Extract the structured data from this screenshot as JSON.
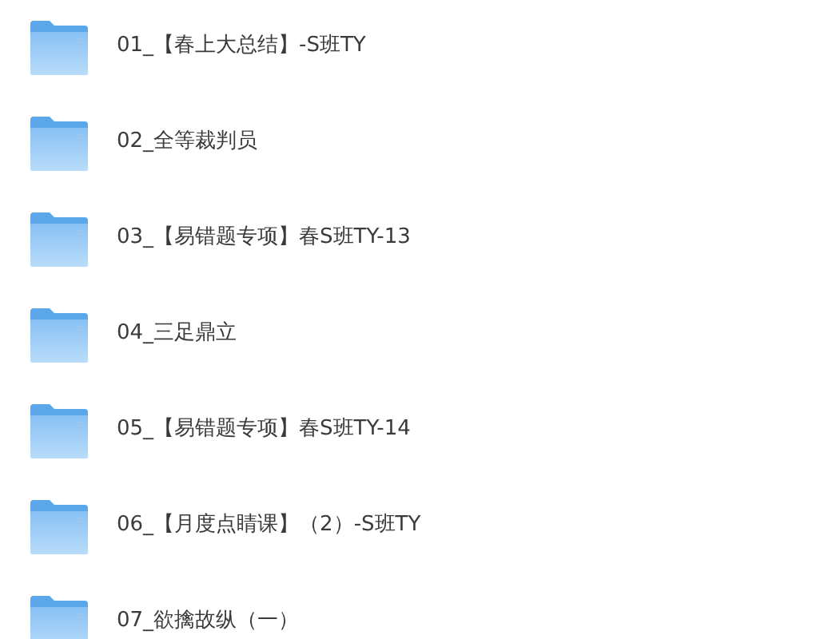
{
  "folders": [
    {
      "name": "01_【春上大总结】-S班TY"
    },
    {
      "name": "02_全等裁判员"
    },
    {
      "name": "03_【易错题专项】春S班TY-13"
    },
    {
      "name": "04_三足鼎立"
    },
    {
      "name": "05_【易错题专项】春S班TY-14"
    },
    {
      "name": "06_【月度点睛课】（2）-S班TY"
    },
    {
      "name": "07_欲擒故纵（一）"
    }
  ]
}
